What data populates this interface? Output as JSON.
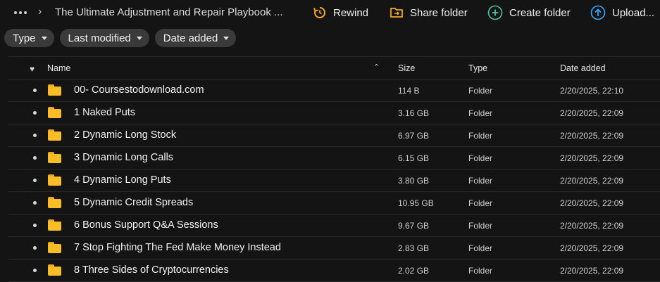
{
  "breadcrumb": {
    "title": "The Ultimate Adjustment and Repair Playbook ..."
  },
  "toolbar": {
    "rewind": "Rewind",
    "share_folder": "Share folder",
    "create_folder": "Create folder",
    "upload": "Upload..."
  },
  "filters": {
    "type": "Type",
    "last_modified": "Last modified",
    "date_added": "Date added"
  },
  "table": {
    "columns": {
      "name": "Name",
      "size": "Size",
      "type": "Type",
      "date_added": "Date added"
    },
    "rows": [
      {
        "name": "00- Coursestodownload.com",
        "size": "114 B",
        "type": "Folder",
        "date": "2/20/2025, 22:10"
      },
      {
        "name": "1 Naked Puts",
        "size": "3.16 GB",
        "type": "Folder",
        "date": "2/20/2025, 22:09"
      },
      {
        "name": "2 Dynamic Long Stock",
        "size": "6.97 GB",
        "type": "Folder",
        "date": "2/20/2025, 22:09"
      },
      {
        "name": "3 Dynamic Long Calls",
        "size": "6.15 GB",
        "type": "Folder",
        "date": "2/20/2025, 22:09"
      },
      {
        "name": "4 Dynamic Long Puts",
        "size": "3.80 GB",
        "type": "Folder",
        "date": "2/20/2025, 22:09"
      },
      {
        "name": "5 Dynamic Credit Spreads",
        "size": "10.95 GB",
        "type": "Folder",
        "date": "2/20/2025, 22:09"
      },
      {
        "name": "6 Bonus Support Q&A Sessions",
        "size": "9.67 GB",
        "type": "Folder",
        "date": "2/20/2025, 22:09"
      },
      {
        "name": "7 Stop Fighting The Fed Make Money Instead",
        "size": "2.83 GB",
        "type": "Folder",
        "date": "2/20/2025, 22:09"
      },
      {
        "name": "8 Three Sides of Cryptocurrencies",
        "size": "2.02 GB",
        "type": "Folder",
        "date": "2/20/2025, 22:09"
      }
    ]
  },
  "colors": {
    "background": "#141414",
    "folder": "#fbbd26",
    "rewind_icon": "#f5a623",
    "create_icon": "#4fc3a1",
    "upload_icon": "#3ea6ff"
  }
}
